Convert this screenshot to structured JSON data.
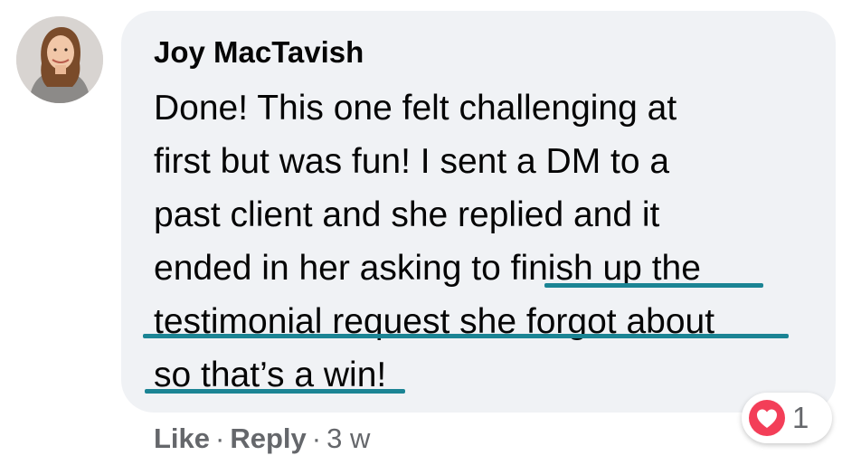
{
  "comment": {
    "author": "Joy MacTavish",
    "lines": [
      "Done! This one felt challenging at",
      "first but was fun! I sent a DM to a",
      "past client and she replied and it",
      "ended in her asking to ",
      "finish up the",
      "testimonial request she forgot about",
      "so that’s a win!"
    ],
    "timestamp": "3 w"
  },
  "actions": {
    "like_label": "Like",
    "reply_label": "Reply",
    "separator": "·"
  },
  "reaction": {
    "icon": "heart-icon",
    "count": "1",
    "color": "#f33e58"
  },
  "highlight_color": "#1b8494"
}
